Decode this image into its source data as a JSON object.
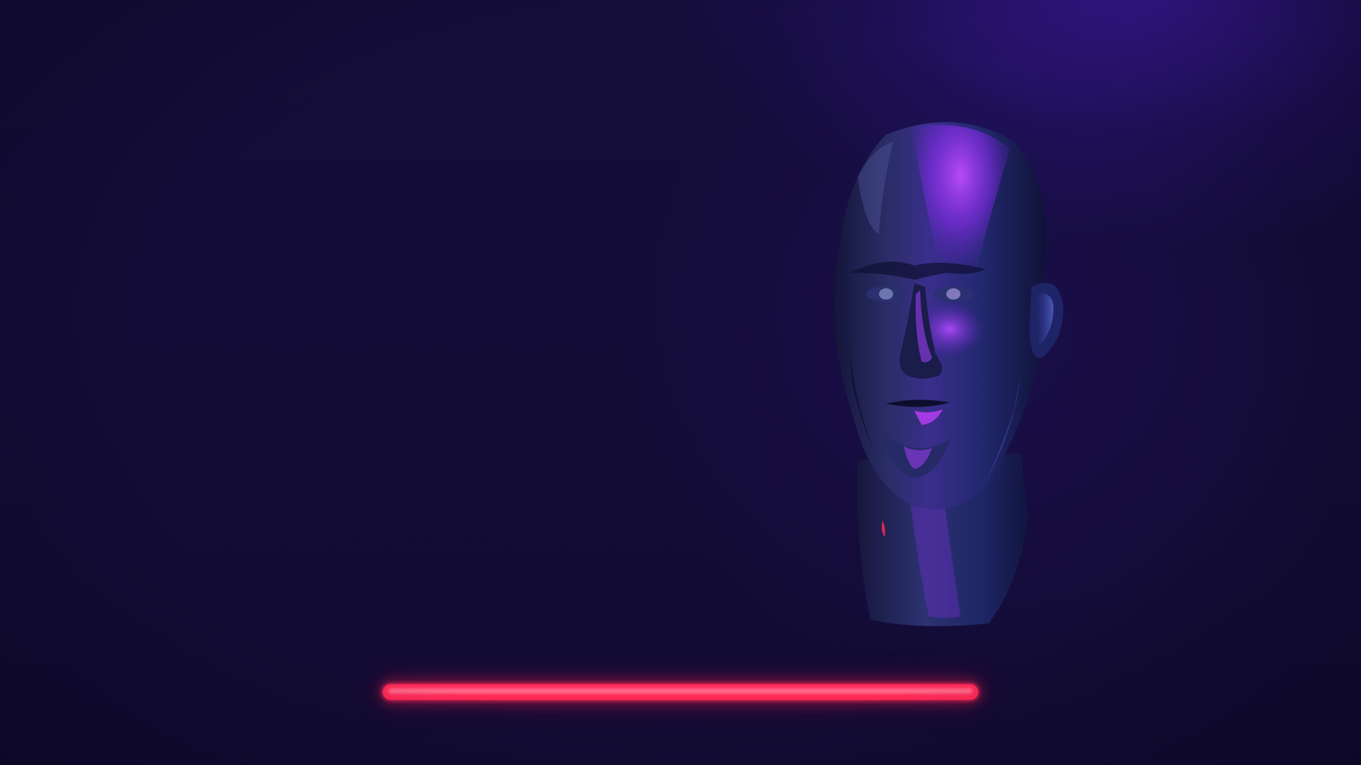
{
  "scene": {
    "background_color": "#120c36",
    "glow_color": "#4a1ebe"
  },
  "head": {
    "subject": "chrome-mannequin-head",
    "base_color": "#1b1f5e",
    "highlight_color": "#a03cff",
    "accent_color": "#ff2a57"
  },
  "loading_bar": {
    "color": "#ff2a57",
    "progress": 1.0
  }
}
